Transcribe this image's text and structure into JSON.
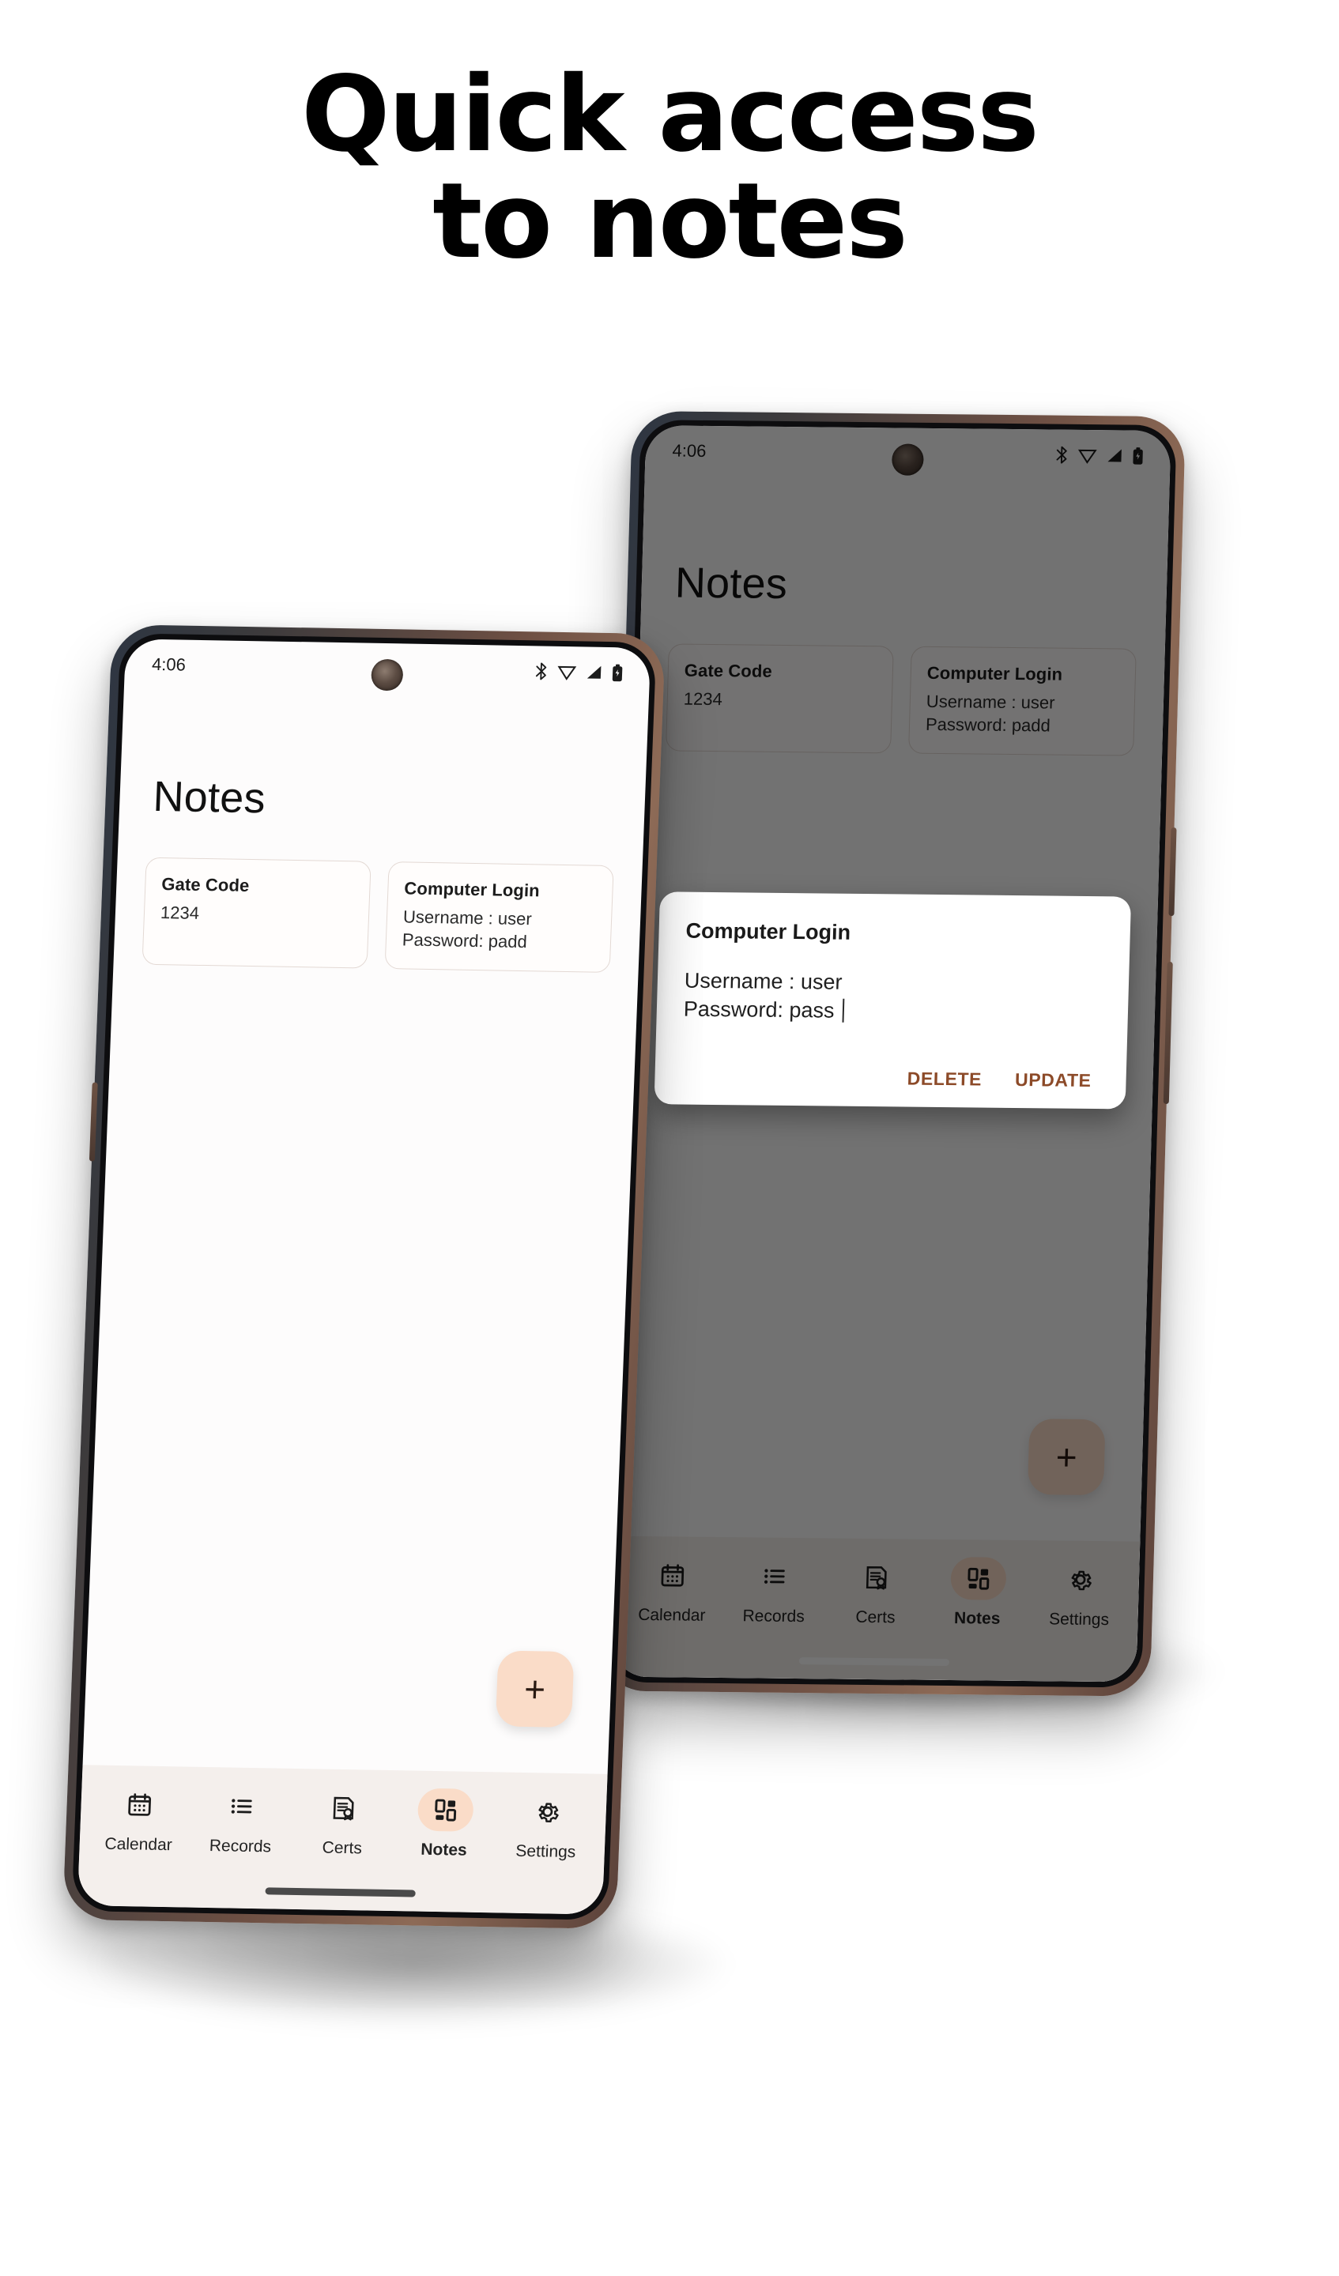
{
  "headline": {
    "line1": "Quick access",
    "line2": "to notes"
  },
  "colors": {
    "accent_peach": "#fadcc8",
    "dialog_action": "#8c4a28",
    "nav_background": "#f4efec",
    "screen_background": "#fdfcfc",
    "card_border": "#e3d9d4",
    "scrim": "rgba(0,0,0,.55)"
  },
  "status_bar": {
    "time": "4:06",
    "icons": [
      "bluetooth-icon",
      "wifi-icon",
      "signal-icon",
      "battery-icon"
    ]
  },
  "app": {
    "title": "Notes",
    "notes": [
      {
        "title": "Gate Code",
        "body": "1234"
      },
      {
        "title": "Computer Login",
        "body": "Username : user\nPassword: padd"
      }
    ],
    "fab_label": "+",
    "nav": [
      {
        "label": "Calendar",
        "icon": "calendar-icon",
        "active": false
      },
      {
        "label": "Records",
        "icon": "list-icon",
        "active": false
      },
      {
        "label": "Certs",
        "icon": "certificate-icon",
        "active": false
      },
      {
        "label": "Notes",
        "icon": "grid-icon",
        "active": true
      },
      {
        "label": "Settings",
        "icon": "gear-icon",
        "active": false
      }
    ]
  },
  "dialog": {
    "title": "Computer Login",
    "body": "Username : user\nPassword: pass",
    "delete_label": "DELETE",
    "update_label": "UPDATE"
  }
}
